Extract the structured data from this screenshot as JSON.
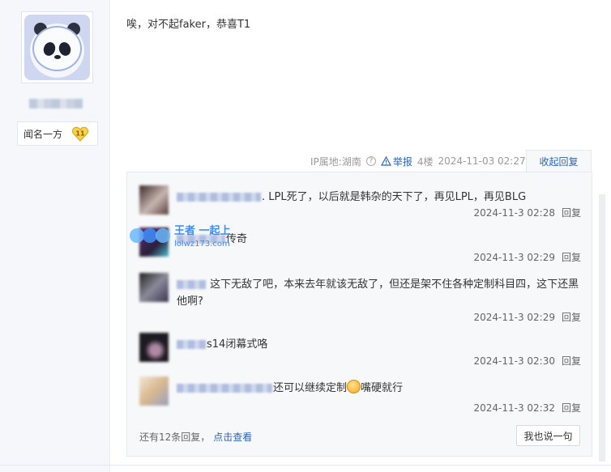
{
  "post": {
    "content": "唉，对不起faker，恭喜T1",
    "meta": {
      "ip_location": "IP属地:湖南",
      "report_label": "举报",
      "floor": "4楼",
      "datetime": "2024-11-03 02:27"
    },
    "collapse_label": "收起回复"
  },
  "author": {
    "title_badge": "闻名一方",
    "level": "11"
  },
  "replies": [
    {
      "text": ". LPL死了，以后就是韩杂的天下了，再见LPL，再见BLG",
      "time": "2024-11-3 02:28",
      "reply_label": "回复"
    },
    {
      "text": "传奇",
      "time": "2024-11-3 02:29",
      "reply_label": "回复"
    },
    {
      "text": "这下无敌了吧，本来去年就该无敌了，但还是架不住各种定制科目四，这下还黑他啊?",
      "time": "2024-11-3 02:29",
      "reply_label": "回复"
    },
    {
      "text": "s14闭幕式咯",
      "time": "2024-11-3 02:30",
      "reply_label": "回复"
    },
    {
      "text_before": "还可以继续定制",
      "text_after": "嘴硬就行",
      "time": "2024-11-3 02:32",
      "reply_label": "回复"
    }
  ],
  "more_replies": {
    "count_text": "还有12条回复，",
    "link_label": "点击查看"
  },
  "say_button_label": "我也说一句",
  "watermark": {
    "brand": "王者 一起上",
    "site": "lolwz173.com"
  },
  "colors": {
    "link_blue": "#2d64b3",
    "panel_bg": "#f7f8fa",
    "sidebar_bg": "#f5f7fb"
  }
}
